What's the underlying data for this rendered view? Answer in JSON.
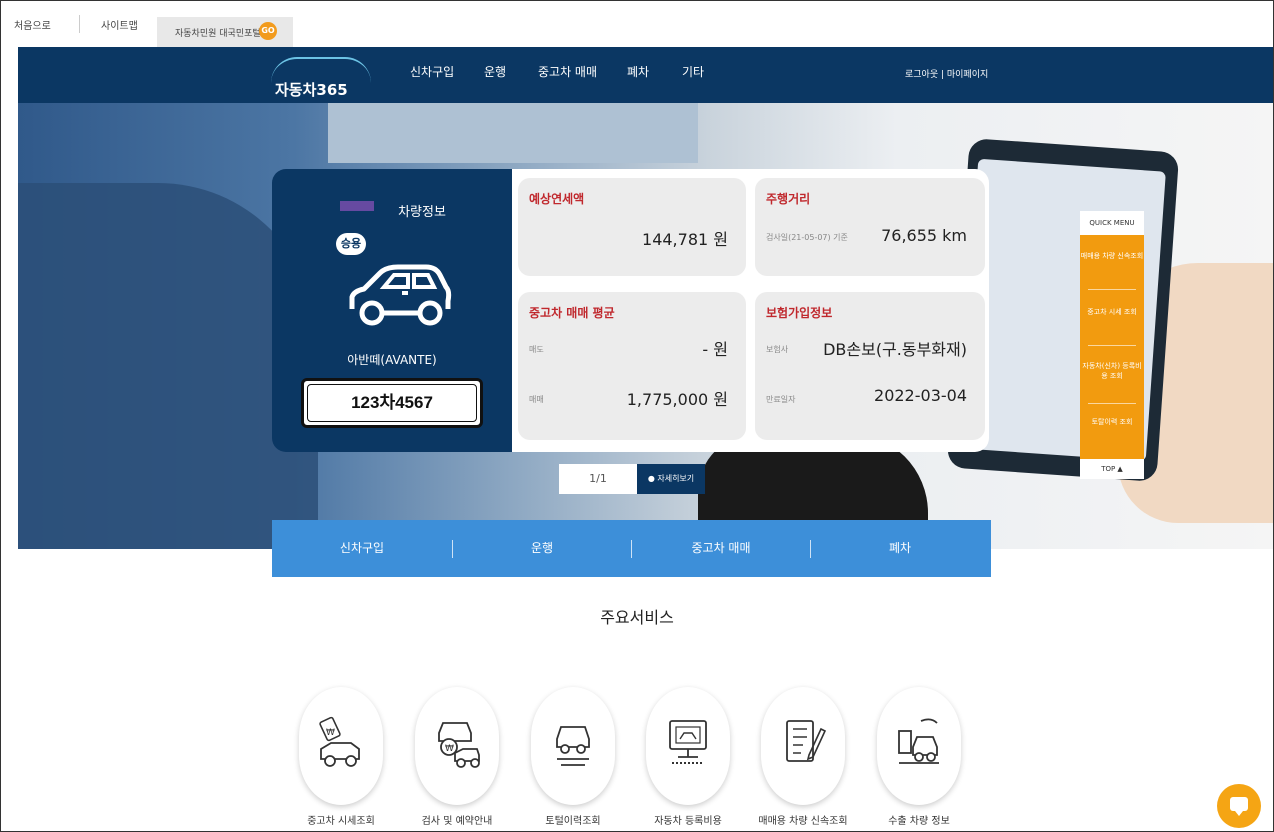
{
  "topbar": {
    "home": "처음으로",
    "sitemap": "사이트맵",
    "portal": "자동차민원 대국민포털",
    "go": "GO"
  },
  "nav": {
    "logo": "자동차365",
    "menu": [
      "신차구입",
      "운행",
      "중고차 매매",
      "폐차",
      "기타"
    ],
    "login": "로그아웃 | 마이페이지"
  },
  "vehicle": {
    "title": "차량정보",
    "type_badge": "승용",
    "model": "아반떼(AVANTE)",
    "plate": "123차4567"
  },
  "info": {
    "tax": {
      "label": "예상연세액",
      "value": "144,781 원"
    },
    "mileage": {
      "label": "주행거리",
      "sub": "검사일(21-05-07) 기준",
      "value": "76,655 km"
    },
    "used_price": {
      "label": "중고차 매매 평균",
      "sell_label": "매도",
      "sell_value": "- 원",
      "buy_label": "매매",
      "buy_value": "1,775,000 원"
    },
    "insurance": {
      "label": "보험가입정보",
      "insurer_label": "보험사",
      "insurer_value": "DB손보(구.동부화재)",
      "expiry_label": "만료일자",
      "expiry_value": "2022-03-04"
    }
  },
  "pager": {
    "page": "1/1",
    "more": "● 자세히보기"
  },
  "subnav": [
    "신차구입",
    "운행",
    "중고차 매매",
    "폐차"
  ],
  "services": {
    "title": "주요서비스",
    "items": [
      "중고차 시세조회",
      "검사 및 예약안내",
      "토털이력조회",
      "자동차 등록비용",
      "매매용 차량 신속조회",
      "수출 차량 정보"
    ]
  },
  "quick_menu": {
    "title": "QUICK MENU",
    "items": [
      "매매용 차량 신속조회",
      "중고차 시세 조회",
      "자동차(신차) 등록비용 조회",
      "토탈이력 조회"
    ],
    "top": "TOP ▲"
  },
  "colors": {
    "navy": "#0b3763",
    "accent_blue": "#3d8fd9",
    "orange": "#f29b0f",
    "red_label": "#c0282d"
  }
}
